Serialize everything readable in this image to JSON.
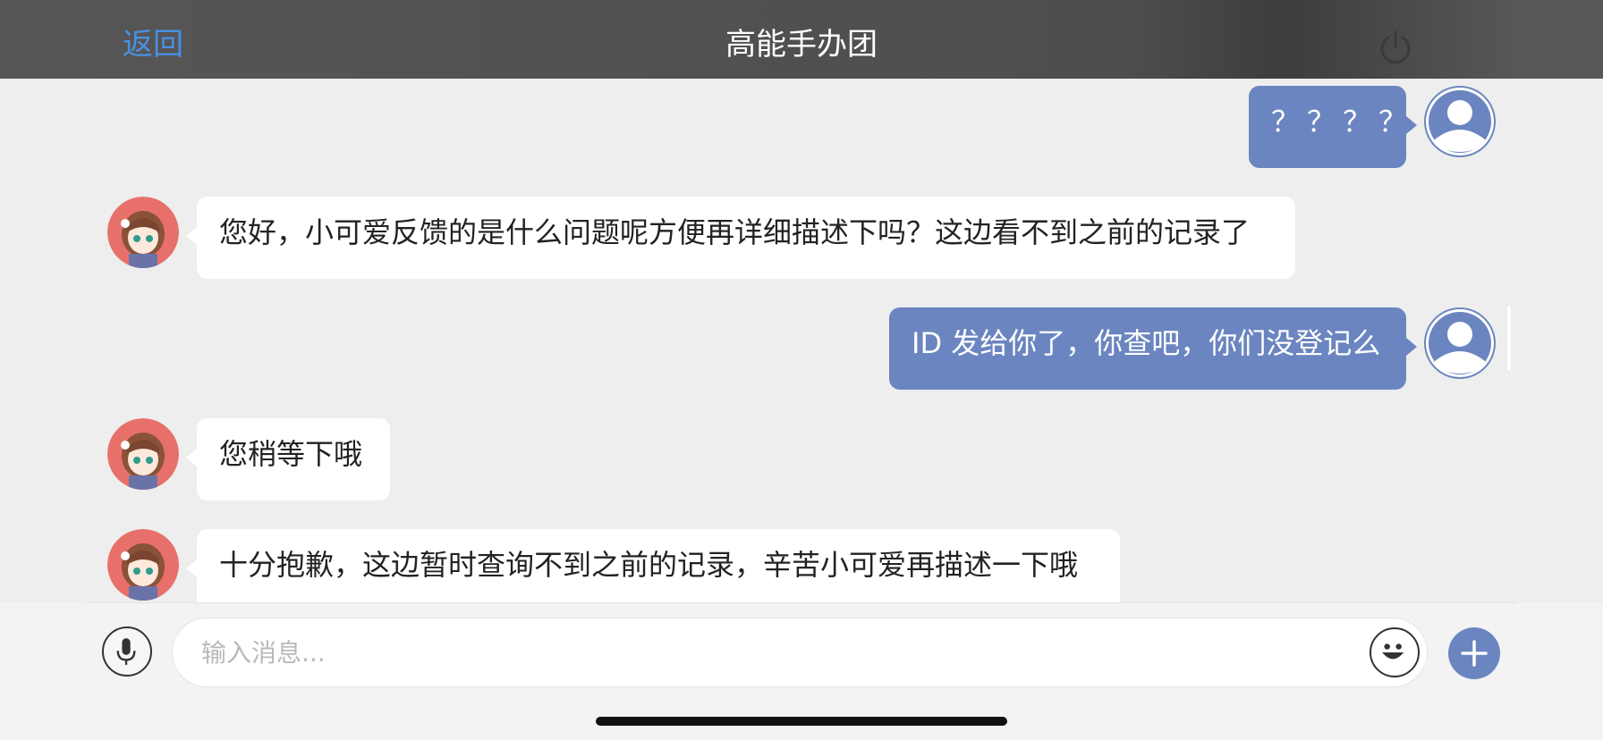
{
  "header": {
    "back_label": "返回",
    "title": "高能手办团",
    "power_icon": "power-icon"
  },
  "messages": [
    {
      "from": "user",
      "text": "？？？？"
    },
    {
      "from": "agent",
      "text": "您好，小可爱反馈的是什么问题呢方便再详细描述下吗？这边看不到之前的记录了"
    },
    {
      "from": "user",
      "text": "ID 发给你了，你查吧，你们没登记么"
    },
    {
      "from": "agent",
      "text": "您稍等下哦"
    },
    {
      "from": "agent",
      "text": "十分抱歉，这边暂时查询不到之前的记录，辛苦小可爱再描述一下哦"
    }
  ],
  "input": {
    "placeholder": "输入消息...",
    "value": ""
  },
  "icons": {
    "voice": "microphone-icon",
    "emoji": "emoji-icon",
    "more": "plus-icon"
  },
  "colors": {
    "accent": "#4a90e2",
    "user_bubble": "#6b85c0",
    "agent_bubble": "#ffffff",
    "header_bg": "#565656"
  }
}
